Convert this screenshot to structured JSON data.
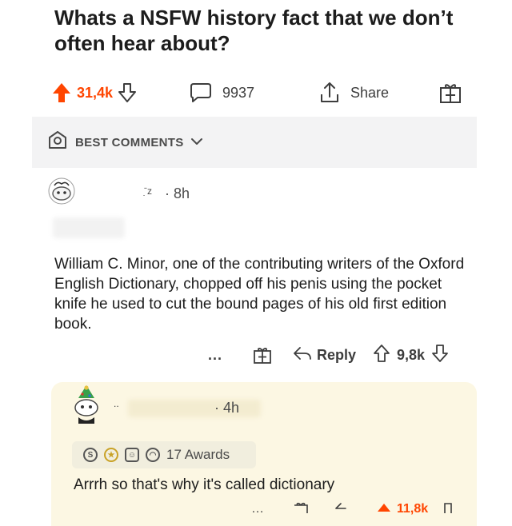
{
  "post": {
    "title": "Whats a NSFW history fact that we don’t often hear about?",
    "upvotes": "31,4k",
    "comments": "9937",
    "share_label": "Share"
  },
  "sort": {
    "label": "BEST COMMENTS"
  },
  "comment": {
    "meta": "· 8h",
    "username_fragment": "ˉ̣ᴢ",
    "body": "William C. Minor, one of the contributing writers of the Oxford English Dictionary, chopped off his penis using the pocket knife he used to cut the bound pages of his old first edition book.",
    "more_label": "...",
    "reply_label": "Reply",
    "score": "9,8k"
  },
  "reply": {
    "meta": "· 4h",
    "username_fragment": "..",
    "awards_label": "17 Awards",
    "body": "Arrrh so that's why it's called dictionary",
    "score_partial": "11,8k"
  },
  "colors": {
    "upvote": "#ff4500",
    "reply_bg": "#fcf7e3",
    "sort_band": "#f3f3f4"
  },
  "icons": [
    "upvote-arrow-icon",
    "downvote-arrow-icon",
    "comment-bubble-icon",
    "share-icon",
    "gift-icon",
    "badge-icon",
    "chevron-down-icon",
    "reply-arrow-icon",
    "more-dots-icon"
  ]
}
